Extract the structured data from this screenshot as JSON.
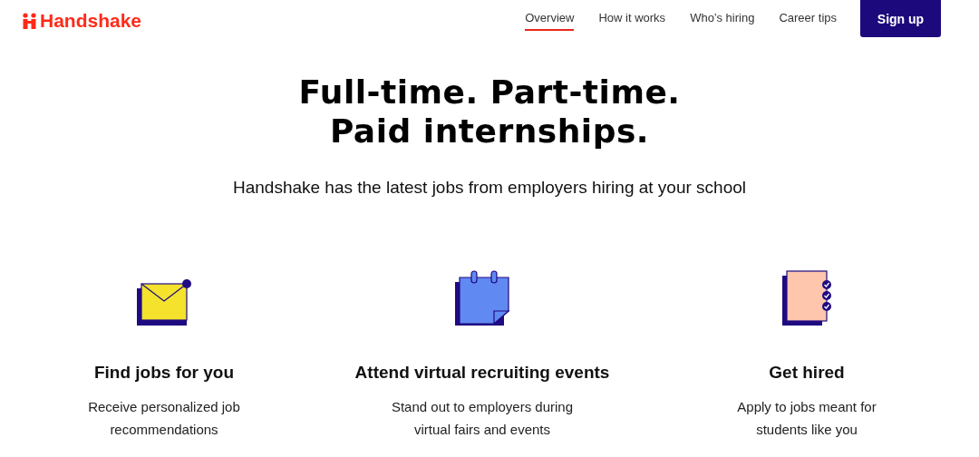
{
  "header": {
    "logo": "Handshake",
    "nav": [
      {
        "label": "Overview",
        "selected": true
      },
      {
        "label": "How it works",
        "selected": false
      },
      {
        "label": "Who’s hiring",
        "selected": false
      },
      {
        "label": "Career tips",
        "selected": false
      }
    ],
    "signup": "Sign up"
  },
  "hero": {
    "title_lines": [
      "Full-time. Part-time.",
      "Paid internships."
    ],
    "subtitle": "Handshake has the latest jobs from employers hiring at your school"
  },
  "features": [
    {
      "kind": "envelope",
      "title": "Find jobs for you",
      "text_lines": [
        "Receive personalized job",
        "recommendations"
      ]
    },
    {
      "kind": "calendar",
      "title": "Attend virtual recruiting events",
      "text_lines": [
        "Stand out to employers during",
        "virtual fairs and events"
      ]
    },
    {
      "kind": "notebook",
      "title": "Get hired",
      "text_lines": [
        "Apply to jobs meant for",
        "students like you"
      ]
    }
  ]
}
